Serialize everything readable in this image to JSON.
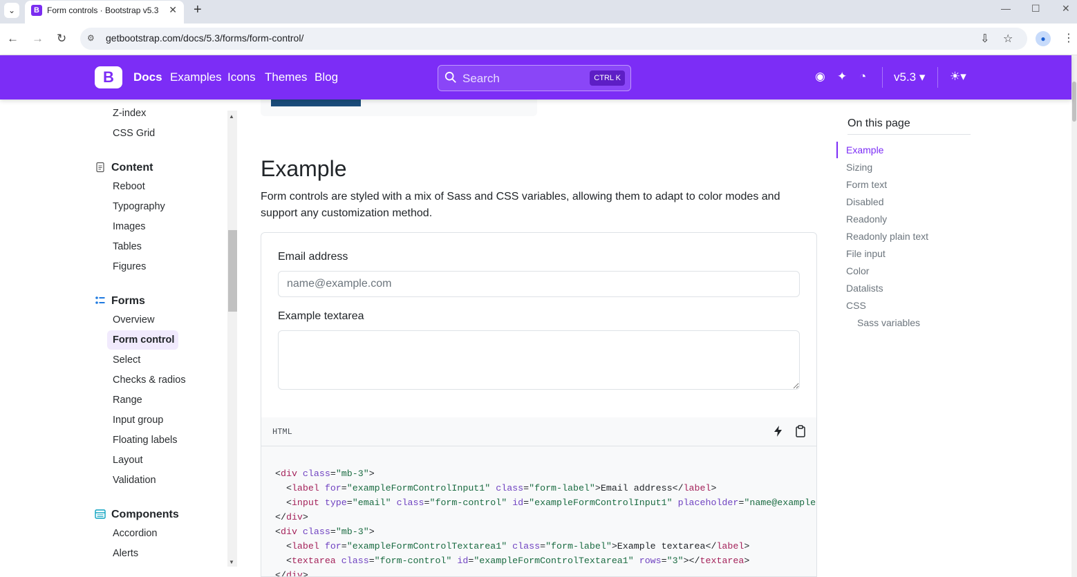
{
  "browser": {
    "tab_title": "Form controls · Bootstrap v5.3",
    "tab_favicon": "B",
    "url": "getbootstrap.com/docs/5.3/forms/form-control/"
  },
  "navbar": {
    "logo": "B",
    "links": [
      "Docs",
      "Examples",
      "Icons",
      "Themes",
      "Blog"
    ],
    "search_placeholder": "Search",
    "search_shortcut": "CTRL K",
    "version": "v5.3 ▾",
    "accent": "#7c2df6"
  },
  "sidebar": {
    "top_items": [
      "Z-index",
      "CSS Grid"
    ],
    "content_heading": "Content",
    "content_items": [
      "Reboot",
      "Typography",
      "Images",
      "Tables",
      "Figures"
    ],
    "forms_heading": "Forms",
    "forms_items": [
      "Overview",
      "Form control",
      "Select",
      "Checks & radios",
      "Range",
      "Input group",
      "Floating labels",
      "Layout",
      "Validation"
    ],
    "components_heading": "Components",
    "components_items": [
      "Accordion",
      "Alerts"
    ]
  },
  "main": {
    "heading": "Example",
    "lead": "Form controls are styled with a mix of Sass and CSS variables, allowing them to adapt to color modes and support any customization method.",
    "email_label": "Email address",
    "email_placeholder": "name@example.com",
    "textarea_label": "Example textarea",
    "code_lang": "HTML"
  },
  "toc": {
    "title": "On this page",
    "items": [
      "Example",
      "Sizing",
      "Form text",
      "Disabled",
      "Readonly",
      "Readonly plain text",
      "File input",
      "Color",
      "Datalists",
      "CSS"
    ],
    "sub_items": [
      "Sass variables"
    ]
  }
}
